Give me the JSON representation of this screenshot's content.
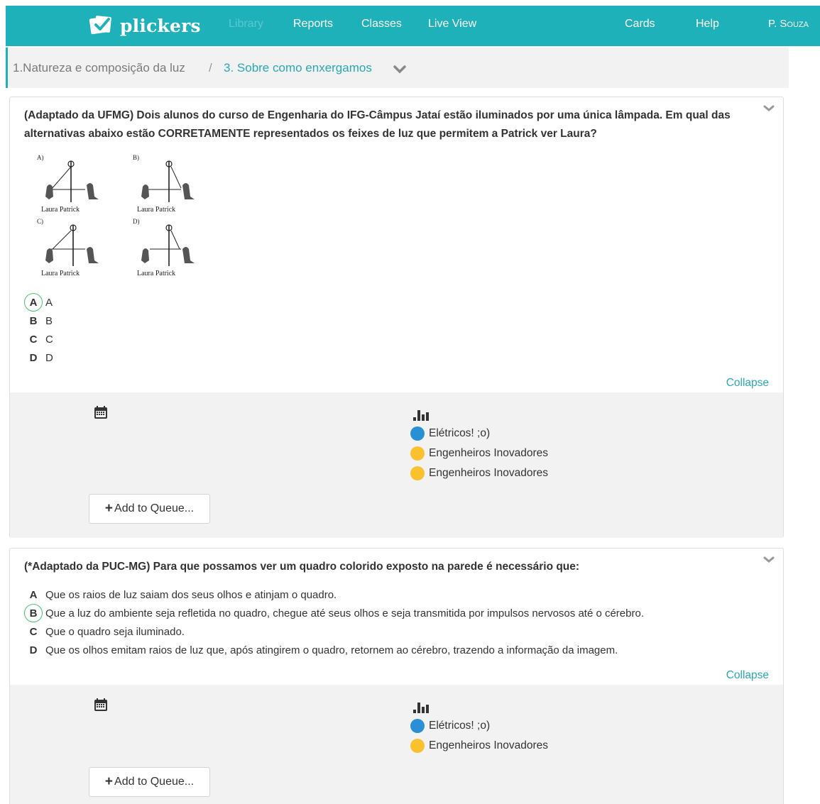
{
  "nav": {
    "brand": "plickers",
    "items": [
      {
        "label": "Library",
        "active": true
      },
      {
        "label": "Reports"
      },
      {
        "label": "Classes"
      },
      {
        "label": "Live View"
      },
      {
        "label": "Cards"
      },
      {
        "label": "Help"
      }
    ],
    "user": "P. Souza"
  },
  "breadcrumb": {
    "parent": "1.Natureza e composição da luz",
    "separator": "/",
    "current": "3. Sobre como enxergamos"
  },
  "questions": [
    {
      "text": "(Adaptado da UFMG) Dois alunos do curso de Engenharia do IFG-Câmpus Jataí estão iluminados por uma única lâmpada. Em qual das alternativas abaixo estão CORRETAMENTE representados os feixes de luz que permitem a Patrick ver Laura?",
      "figure": {
        "panels": [
          {
            "label": "A)",
            "names": "Laura Patrick"
          },
          {
            "label": "B)",
            "names": "Laura Patrick"
          },
          {
            "label": "C)",
            "names": "Laura Patrick"
          },
          {
            "label": "D)",
            "names": "Laura Patrick"
          }
        ]
      },
      "choices": [
        {
          "letter": "A",
          "text": "A",
          "correct": true
        },
        {
          "letter": "B",
          "text": "B"
        },
        {
          "letter": "C",
          "text": "C"
        },
        {
          "letter": "D",
          "text": "D"
        }
      ],
      "collapse": "Collapse",
      "sections": [
        {
          "name": "Elétricos! ;o)",
          "color": "#2b8fd6"
        },
        {
          "name": "Engenheiros Inovadores",
          "color": "#fbc02d"
        },
        {
          "name": "Engenheiros Inovadores",
          "color": "#fbc02d"
        }
      ],
      "queue_button": "Add to Queue..."
    },
    {
      "text": "(*Adaptado da PUC-MG) Para que possamos ver um quadro colorido exposto na parede é necessário que:",
      "choices": [
        {
          "letter": "A",
          "text": "Que os raios de luz saiam dos seus olhos e atinjam o quadro."
        },
        {
          "letter": "B",
          "text": "Que a luz do ambiente seja refletida no quadro, chegue até seus olhos e seja transmitida por impulsos nervosos até o cérebro.",
          "correct": true
        },
        {
          "letter": "C",
          "text": "Que o quadro seja iluminado."
        },
        {
          "letter": "D",
          "text": "Que os olhos emitam raios de luz que, após atingirem o quadro, retornem ao cérebro, trazendo a informação da imagem."
        }
      ],
      "collapse": "Collapse",
      "sections": [
        {
          "name": "Elétricos! ;o)",
          "color": "#2b8fd6"
        },
        {
          "name": "Engenheiros Inovadores",
          "color": "#fbc02d"
        }
      ],
      "queue_button": "Add to Queue..."
    }
  ]
}
